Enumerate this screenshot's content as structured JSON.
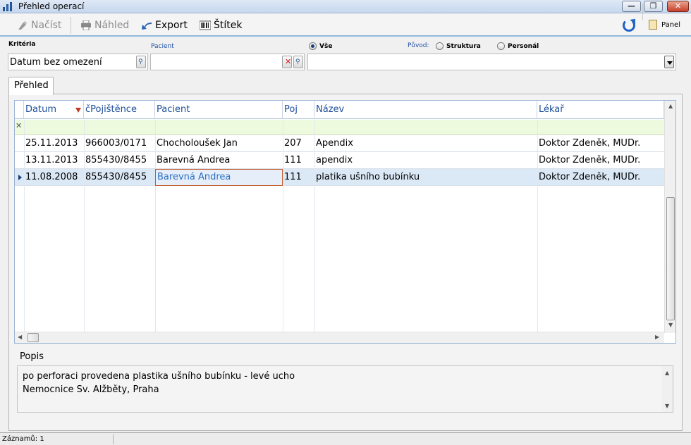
{
  "window": {
    "title": "Přehled operací",
    "min_glyph": "—",
    "max_glyph": "❐",
    "close_glyph": "✕"
  },
  "toolbar": {
    "nacist_label": "Načíst",
    "nahled_label": "Náhled",
    "export_label": "Export",
    "stitek_label": "Štítek",
    "panel_label": "Panel",
    "icons": [
      "load-icon",
      "printer-icon",
      "export-arrow-icon",
      "barcode-icon",
      "refresh-icon",
      "panel-icon"
    ]
  },
  "criteria": {
    "label": "Kritéria",
    "date_value": "Datum bez omezení",
    "patient_label": "Pacient",
    "patient_value": "",
    "vse_label": "Vše",
    "puvod_label": "Původ:",
    "struktura_label": "Struktura",
    "personal_label": "Personál",
    "selected_radio": "Vše",
    "combo_value": ""
  },
  "tab": {
    "label": "Přehled"
  },
  "grid": {
    "columns": [
      "Datum",
      "čPojištěnce",
      "Pacient",
      "Poj",
      "Název",
      "Lékař"
    ],
    "sort_column": "Datum",
    "filter_clear_glyph": "✕",
    "rows": [
      {
        "datum": "25.11.2013",
        "cpoj": "966003/0171",
        "pacient": "Chocholoušek Jan",
        "poj": "207",
        "nazev": "Apendix",
        "lekar": "Doktor Zdeněk, MUDr."
      },
      {
        "datum": "13.11.2013",
        "cpoj": "855430/8455",
        "pacient": "Barevná Andrea",
        "poj": "111",
        "nazev": "apendix",
        "lekar": "Doktor Zdeněk, MUDr."
      },
      {
        "datum": "11.08.2008",
        "cpoj": "855430/8455",
        "pacient": "Barevná Andrea",
        "poj": "111",
        "nazev": "platika ušního bubínku",
        "lekar": "Doktor Zdeněk, MUDr."
      }
    ],
    "selected_row": 2
  },
  "popis": {
    "label": "Popis",
    "lines": [
      "po perforaci provedena plastika ušního bubínku - levé ucho",
      "Nemocnice Sv. Alžběty, Praha"
    ]
  },
  "status": {
    "text": "Záznamů: 1"
  },
  "colors": {
    "accent": "#1d4f9a",
    "filter_row": "#eefadd",
    "selected_row": "#dbe8f6",
    "toolbar_line": "#8fb9dd"
  }
}
